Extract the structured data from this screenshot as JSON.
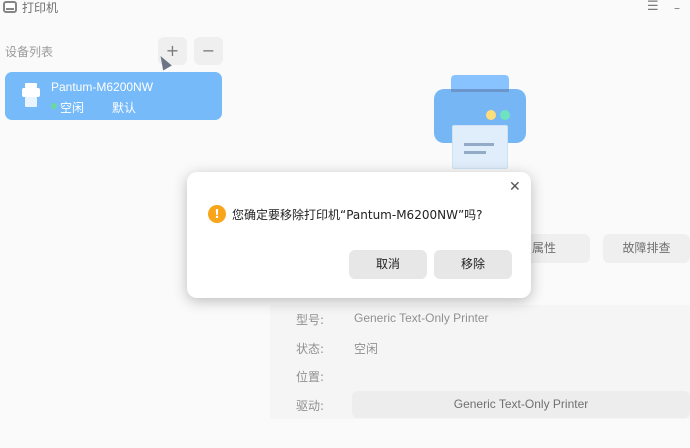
{
  "window": {
    "title": "打印机",
    "menu_icon": "☰",
    "minimize_icon": "–"
  },
  "sidebar": {
    "title": "设备列表",
    "add_label": "+",
    "remove_label": "−",
    "devices": [
      {
        "name": "Pantum-M6200NW",
        "status": "空闲",
        "default_label": "默认"
      }
    ]
  },
  "detail": {
    "properties_label": "属性",
    "troubleshoot_label": "故障排查",
    "fields": {
      "model_label": "型号:",
      "model_value": "Generic Text-Only Printer",
      "status_label": "状态:",
      "status_value": "空闲",
      "location_label": "位置:",
      "location_value": "",
      "driver_label": "驱动:",
      "driver_value": "Generic Text-Only Printer"
    }
  },
  "dialog": {
    "message": "您确定要移除打印机“Pantum-M6200NW”吗?",
    "cancel_label": "取消",
    "confirm_label": "移除",
    "close_icon": "✕",
    "warn_icon": "!"
  },
  "colors": {
    "accent": "#2d96f8",
    "status_dot": "#19c46b",
    "warning": "#f8a51c"
  }
}
